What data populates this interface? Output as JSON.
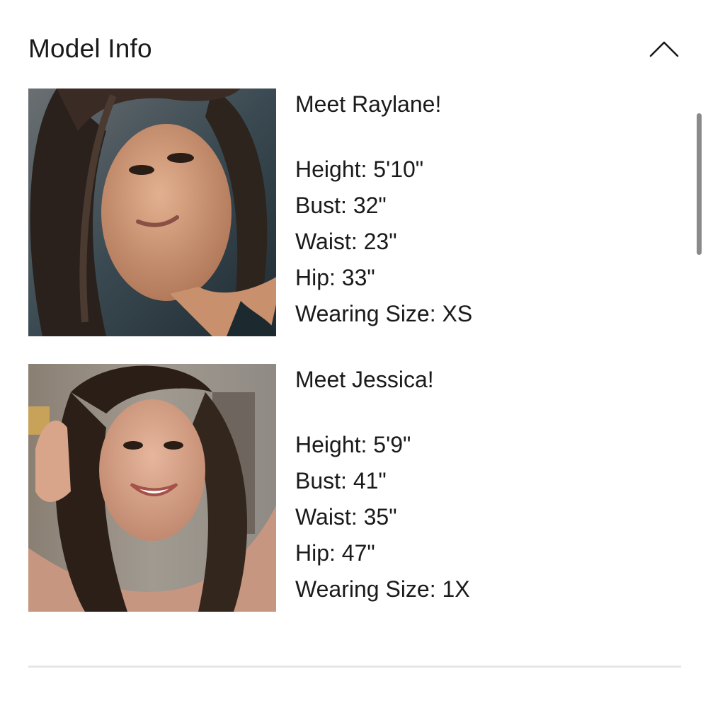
{
  "section": {
    "title": "Model Info",
    "toggle_icon": "chevron-up-icon"
  },
  "models": [
    {
      "intro": "Meet Raylane!",
      "photo_icon": "model-photo",
      "stats": [
        "Height: 5'10\"",
        "Bust: 32\"",
        "Waist: 23\"",
        "Hip: 33\"",
        "Wearing Size: XS"
      ]
    },
    {
      "intro": "Meet Jessica!",
      "photo_icon": "model-photo",
      "stats": [
        "Height: 5'9\"",
        "Bust: 41\"",
        "Waist: 35\"",
        "Hip: 47\"",
        "Wearing Size: 1X"
      ]
    }
  ],
  "colors": {
    "text": "#1a1a1a",
    "divider": "#e6e6e6",
    "scrollbar": "#8a8a8a"
  }
}
